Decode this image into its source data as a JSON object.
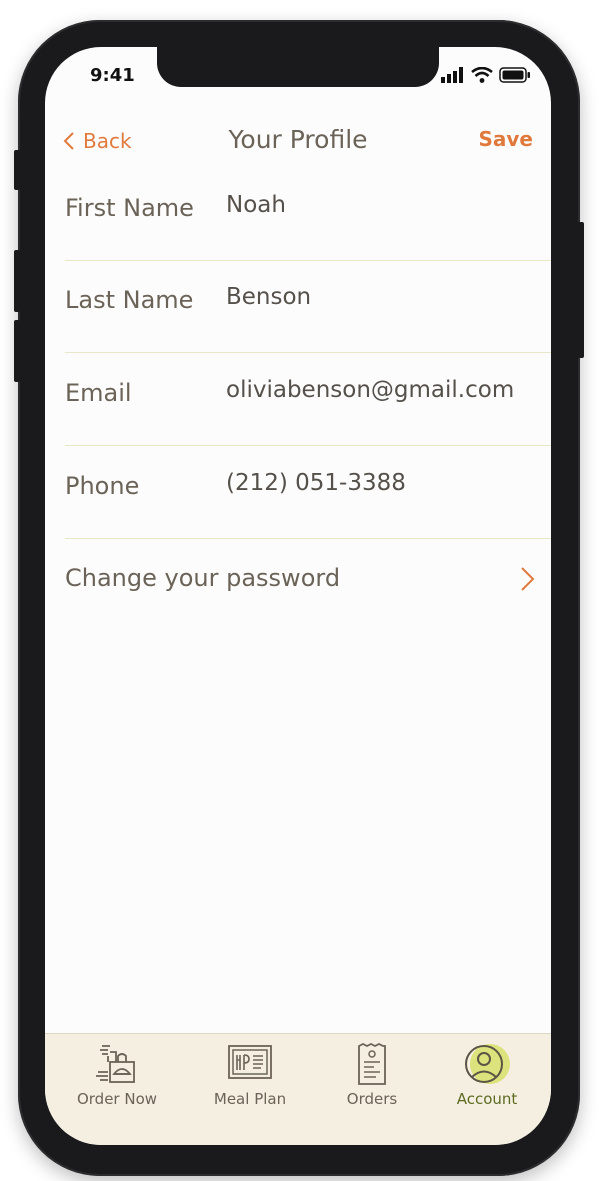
{
  "status": {
    "time": "9:41"
  },
  "nav": {
    "back_label": "Back",
    "title": "Your Profile",
    "save_label": "Save"
  },
  "profile": {
    "fields": [
      {
        "label": "First Name",
        "value": "Noah"
      },
      {
        "label": "Last Name",
        "value": "Benson"
      },
      {
        "label": "Email",
        "value": "oliviabenson@gmail.com"
      },
      {
        "label": "Phone",
        "value": "(212) 051-3388"
      }
    ],
    "change_password_label": "Change your password"
  },
  "tabbar": {
    "tabs": [
      {
        "label": "Order Now",
        "icon": "order-now-icon"
      },
      {
        "label": "Meal Plan",
        "icon": "meal-plan-icon"
      },
      {
        "label": "Orders",
        "icon": "receipt-icon"
      },
      {
        "label": "Account",
        "icon": "account-icon",
        "active": true
      }
    ]
  },
  "colors": {
    "accent": "#e07a3c",
    "text": "#6b6357",
    "divider": "#e8e7c9",
    "tabbar_bg": "#f4efe1",
    "active_highlight": "#d4df5a"
  }
}
